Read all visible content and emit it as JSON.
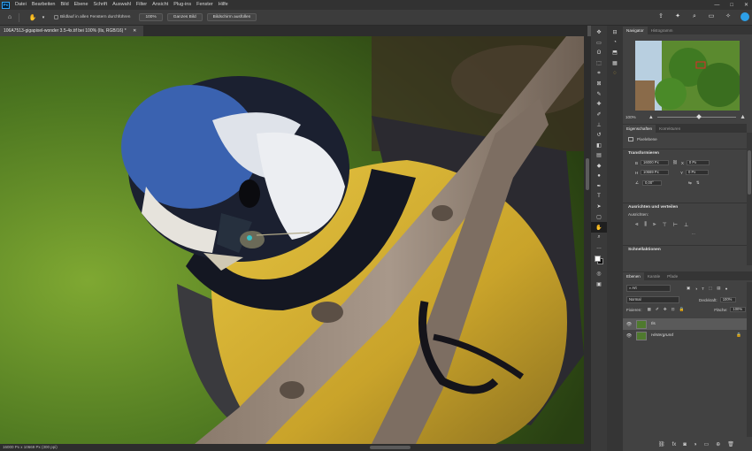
{
  "app": {
    "logo": "Ps"
  },
  "menu": {
    "items": [
      "Datei",
      "Bearbeiten",
      "Bild",
      "Ebene",
      "Schrift",
      "Auswahl",
      "Filter",
      "Ansicht",
      "Plug-ins",
      "Fenster",
      "Hilfe"
    ]
  },
  "window_controls": {
    "minimize": "—",
    "maximize": "□",
    "close": "✕"
  },
  "options_bar": {
    "scroll_all_label": "Bildlauf in allen Fenstern durchführen",
    "zoom_100": "100%",
    "fit_screen": "Ganzes Bild",
    "fill_screen": "Bildschirm ausfüllen"
  },
  "document": {
    "tab_title": "106A7513-gigapixel-wonder 3.5-4x.tif bei 100% (Ils, RGB/16) *",
    "close": "✕"
  },
  "status": {
    "doc_size": "16000 Px x 10669 Px (300 ppi)"
  },
  "panels": {
    "navigator": {
      "tabs": [
        "Navigator",
        "Histogramm"
      ],
      "zoom": "100%"
    },
    "properties": {
      "tabs": [
        "Eigenschaften",
        "Korrekturen"
      ],
      "layer_type": "Pixelebene",
      "transform_title": "Transformieren",
      "w_label": "B",
      "w_value": "16000 Px",
      "h_label": "H",
      "h_value": "10669 Px",
      "x_label": "X",
      "x_value": "0 Px",
      "y_label": "Y",
      "y_value": "0 Px",
      "angle_value": "0,00°",
      "align_title": "Ausrichten und verteilen",
      "align_sub": "Ausrichten:",
      "more": "...",
      "quick_actions_title": "Schnellaktionen"
    },
    "layers": {
      "tabs": [
        "Ebenen",
        "Kanäle",
        "Pfade"
      ],
      "kind_filter": "Art",
      "blend_mode": "Normal",
      "opacity_label": "Deckkraft:",
      "opacity_value": "100%",
      "lock_label": "Fixieren:",
      "fill_label": "Fläche:",
      "fill_value": "100%",
      "layers": [
        {
          "name": "Ils",
          "italic": false,
          "locked": false
        },
        {
          "name": "Hintergrund",
          "italic": true,
          "locked": true
        }
      ]
    }
  }
}
